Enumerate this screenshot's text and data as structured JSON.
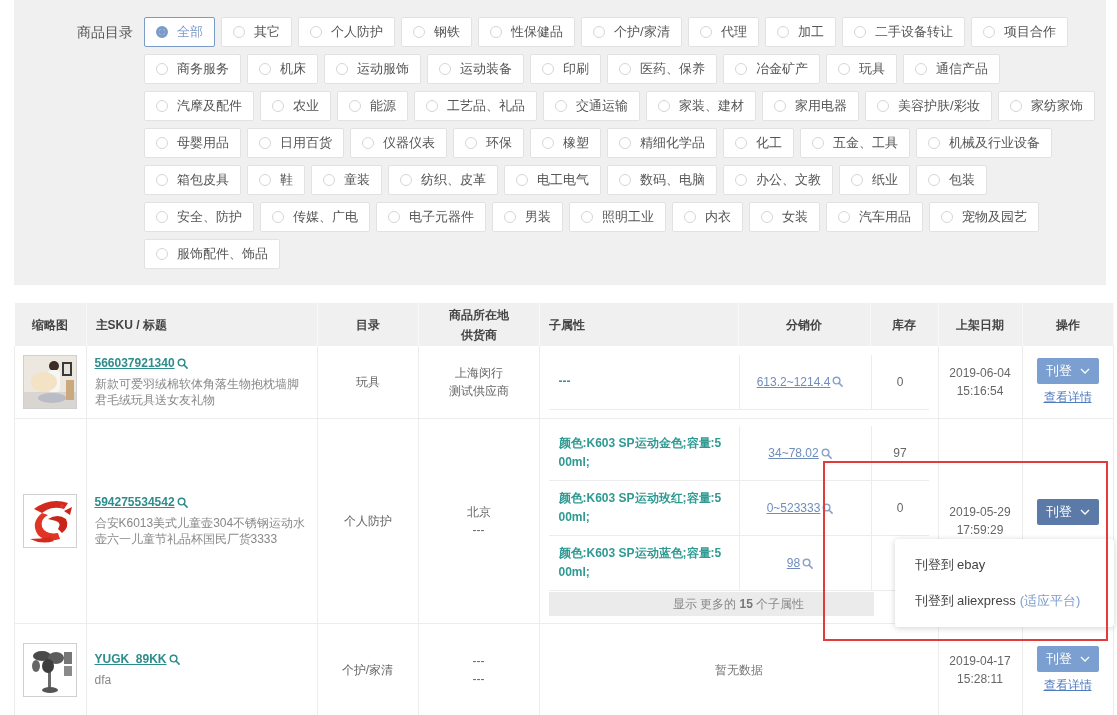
{
  "category_filter": {
    "label": "商品目录",
    "options": [
      {
        "label": "全部",
        "selected": true
      },
      {
        "label": "其它",
        "selected": false
      },
      {
        "label": "个人防护",
        "selected": false
      },
      {
        "label": "钢铁",
        "selected": false
      },
      {
        "label": "性保健品",
        "selected": false
      },
      {
        "label": "个护/家清",
        "selected": false
      },
      {
        "label": "代理",
        "selected": false
      },
      {
        "label": "加工",
        "selected": false
      },
      {
        "label": "二手设备转让",
        "selected": false
      },
      {
        "label": "项目合作",
        "selected": false
      },
      {
        "label": "商务服务",
        "selected": false
      },
      {
        "label": "机床",
        "selected": false
      },
      {
        "label": "运动服饰",
        "selected": false
      },
      {
        "label": "运动装备",
        "selected": false
      },
      {
        "label": "印刷",
        "selected": false
      },
      {
        "label": "医药、保养",
        "selected": false
      },
      {
        "label": "冶金矿产",
        "selected": false
      },
      {
        "label": "玩具",
        "selected": false
      },
      {
        "label": "通信产品",
        "selected": false
      },
      {
        "label": "汽摩及配件",
        "selected": false
      },
      {
        "label": "农业",
        "selected": false
      },
      {
        "label": "能源",
        "selected": false
      },
      {
        "label": "工艺品、礼品",
        "selected": false
      },
      {
        "label": "交通运输",
        "selected": false
      },
      {
        "label": "家装、建材",
        "selected": false
      },
      {
        "label": "家用电器",
        "selected": false
      },
      {
        "label": "美容护肤/彩妆",
        "selected": false
      },
      {
        "label": "家纺家饰",
        "selected": false
      },
      {
        "label": "母婴用品",
        "selected": false
      },
      {
        "label": "日用百货",
        "selected": false
      },
      {
        "label": "仪器仪表",
        "selected": false
      },
      {
        "label": "环保",
        "selected": false
      },
      {
        "label": "橡塑",
        "selected": false
      },
      {
        "label": "精细化学品",
        "selected": false
      },
      {
        "label": "化工",
        "selected": false
      },
      {
        "label": "五金、工具",
        "selected": false
      },
      {
        "label": "机械及行业设备",
        "selected": false
      },
      {
        "label": "箱包皮具",
        "selected": false
      },
      {
        "label": "鞋",
        "selected": false
      },
      {
        "label": "童装",
        "selected": false
      },
      {
        "label": "纺织、皮革",
        "selected": false
      },
      {
        "label": "电工电气",
        "selected": false
      },
      {
        "label": "数码、电脑",
        "selected": false
      },
      {
        "label": "办公、文教",
        "selected": false
      },
      {
        "label": "纸业",
        "selected": false
      },
      {
        "label": "包装",
        "selected": false
      },
      {
        "label": "安全、防护",
        "selected": false
      },
      {
        "label": "传媒、广电",
        "selected": false
      },
      {
        "label": "电子元器件",
        "selected": false
      },
      {
        "label": "男装",
        "selected": false
      },
      {
        "label": "照明工业",
        "selected": false
      },
      {
        "label": "内衣",
        "selected": false
      },
      {
        "label": "女装",
        "selected": false
      },
      {
        "label": "汽车用品",
        "selected": false
      },
      {
        "label": "宠物及园艺",
        "selected": false
      },
      {
        "label": "服饰配件、饰品",
        "selected": false
      }
    ]
  },
  "table": {
    "columns": [
      {
        "label": "缩略图"
      },
      {
        "label": "主SKU / 标题"
      },
      {
        "label": "目录"
      },
      {
        "label": "商品所在地",
        "sublabel": "供货商"
      },
      {
        "label": "子属性"
      },
      {
        "label": "分销价"
      },
      {
        "label": "库存"
      },
      {
        "label": "上架日期"
      },
      {
        "label": "操作"
      }
    ],
    "rows": [
      {
        "sku": "566037921340",
        "title": "新款可爱羽绒棉软体角落生物抱枕墙脚君毛绒玩具送女友礼物",
        "category": "玩具",
        "location": "上海闵行",
        "supplier": "测试供应商",
        "variants": [
          {
            "attribute": "---",
            "price": "613.2~1214.4",
            "stock": "0"
          }
        ],
        "date": "2019-06-04",
        "time": "15:16:54",
        "action": {
          "label": "刊登",
          "open": false
        },
        "detail_link": "查看详情"
      },
      {
        "sku": "594275534542",
        "title": "合安K6013美式儿童壶304不锈钢运动水壶六一儿童节礼品杯国民厂货3333",
        "category": "个人防护",
        "location": "北京",
        "supplier": "---",
        "variants": [
          {
            "attribute": "颜色:K603 SP运动金色;容量:500ml;",
            "price": "34~78.02",
            "stock": "97"
          },
          {
            "attribute": "颜色:K603 SP运动玫红;容量:500ml;",
            "price": "0~523333",
            "stock": "0"
          },
          {
            "attribute": "颜色:K603 SP运动蓝色;容量:500ml;",
            "price": "98"
          }
        ],
        "more_variants": "显示 更多的 **15** 个子属性",
        "date": "2019-05-29",
        "time": "17:59:29",
        "action": {
          "label": "刊登",
          "open": true,
          "menu": [
            {
              "label": "刊登到 ebay"
            },
            {
              "label": "刊登到 aliexpress",
              "note": "(适应平台)"
            }
          ]
        }
      },
      {
        "sku": "YUGK_89KK",
        "title": "dfa",
        "category": "个护/家清",
        "location": "---",
        "supplier": "---",
        "empty_text": "暂无数据",
        "date": "2019-04-17",
        "time": "15:28:11",
        "action": {
          "label": "刊登",
          "open": false
        },
        "detail_link": "查看详情"
      }
    ]
  },
  "annotations": [
    {
      "kind": "rectangle"
    }
  ]
}
